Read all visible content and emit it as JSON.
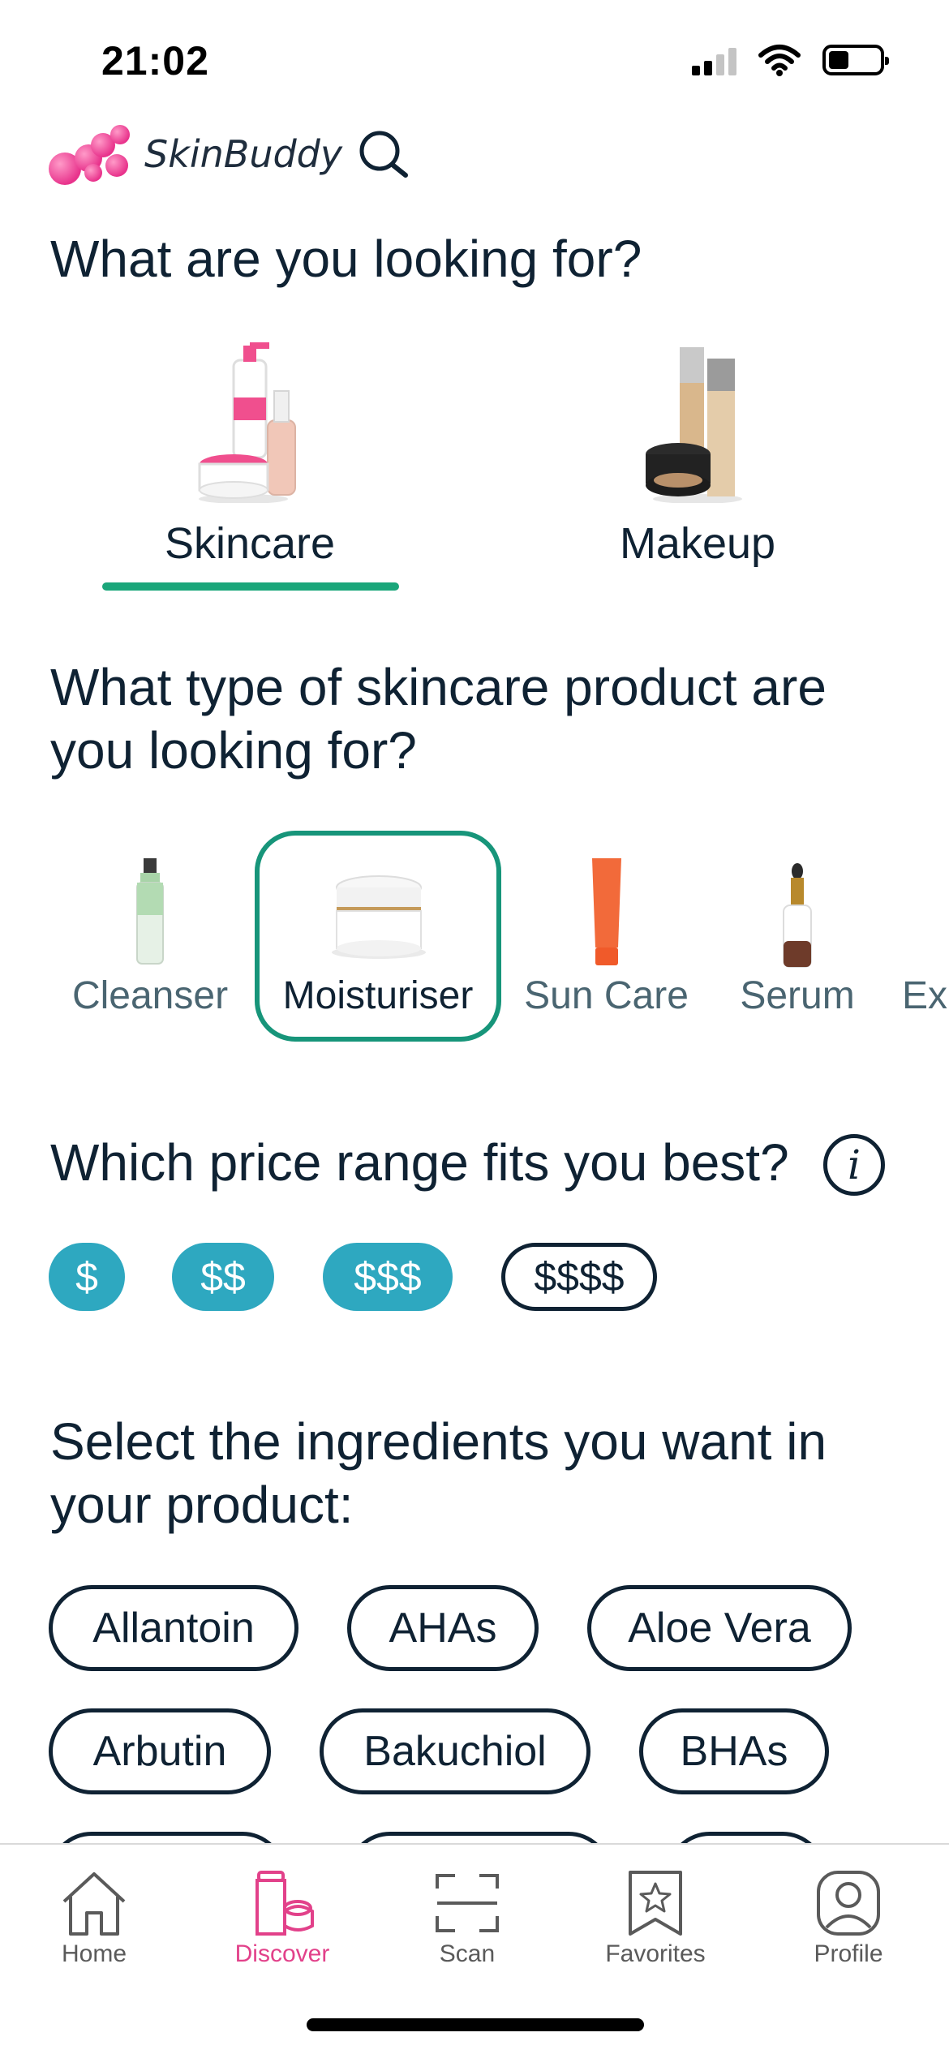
{
  "status_bar": {
    "time": "21:02"
  },
  "header": {
    "app_name": "SkinBuddy"
  },
  "category_section": {
    "title": "What are you looking for?",
    "categories": [
      {
        "label": "Skincare",
        "selected": true
      },
      {
        "label": "Makeup",
        "selected": false
      }
    ]
  },
  "type_section": {
    "title": "What type of skincare product are you looking for?",
    "types": [
      {
        "label": "Cleanser",
        "selected": false
      },
      {
        "label": "Moisturiser",
        "selected": true
      },
      {
        "label": "Sun Care",
        "selected": false
      },
      {
        "label": "Serum",
        "selected": false
      },
      {
        "label": "Ex",
        "selected": false
      }
    ]
  },
  "price_section": {
    "title": "Which price range fits you best?",
    "info_glyph": "i",
    "options": [
      {
        "label": "$",
        "selected": true
      },
      {
        "label": "$$",
        "selected": true
      },
      {
        "label": "$$$",
        "selected": true
      },
      {
        "label": "$$$$",
        "selected": false
      }
    ]
  },
  "ingredient_section": {
    "title": "Select the ingredients you want in your product:",
    "chips": [
      "Allantoin",
      "AHAs",
      "Aloe Vera",
      "Arbutin",
      "Bakuchiol",
      "BHAs"
    ]
  },
  "tab_bar": {
    "items": [
      {
        "label": "Home",
        "icon": "home-icon",
        "active": false
      },
      {
        "label": "Discover",
        "icon": "discover-icon",
        "active": true
      },
      {
        "label": "Scan",
        "icon": "scan-icon",
        "active": false
      },
      {
        "label": "Favorites",
        "icon": "favorites-icon",
        "active": false
      },
      {
        "label": "Profile",
        "icon": "profile-icon",
        "active": false
      }
    ]
  },
  "colors": {
    "accent_green": "#17957a",
    "price_selected": "#2ea8c0",
    "brand_pink": "#e2418a",
    "text_dark": "#0f2233"
  }
}
